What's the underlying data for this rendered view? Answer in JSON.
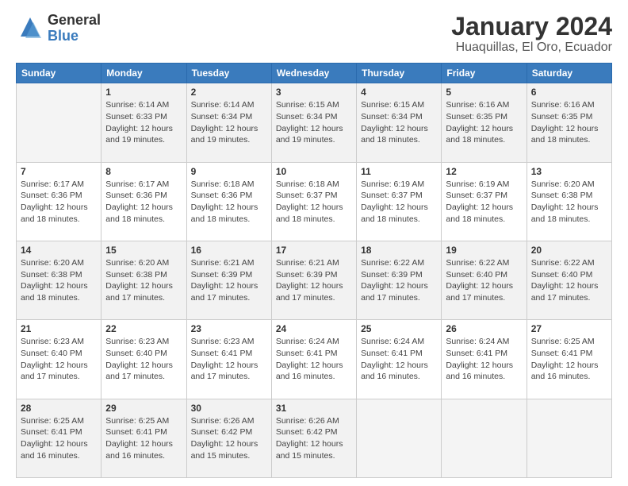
{
  "logo": {
    "general": "General",
    "blue": "Blue"
  },
  "title": "January 2024",
  "subtitle": "Huaquillas, El Oro, Ecuador",
  "days_header": [
    "Sunday",
    "Monday",
    "Tuesday",
    "Wednesday",
    "Thursday",
    "Friday",
    "Saturday"
  ],
  "weeks": [
    [
      {
        "day": "",
        "info": ""
      },
      {
        "day": "1",
        "info": "Sunrise: 6:14 AM\nSunset: 6:33 PM\nDaylight: 12 hours\nand 19 minutes."
      },
      {
        "day": "2",
        "info": "Sunrise: 6:14 AM\nSunset: 6:34 PM\nDaylight: 12 hours\nand 19 minutes."
      },
      {
        "day": "3",
        "info": "Sunrise: 6:15 AM\nSunset: 6:34 PM\nDaylight: 12 hours\nand 19 minutes."
      },
      {
        "day": "4",
        "info": "Sunrise: 6:15 AM\nSunset: 6:34 PM\nDaylight: 12 hours\nand 18 minutes."
      },
      {
        "day": "5",
        "info": "Sunrise: 6:16 AM\nSunset: 6:35 PM\nDaylight: 12 hours\nand 18 minutes."
      },
      {
        "day": "6",
        "info": "Sunrise: 6:16 AM\nSunset: 6:35 PM\nDaylight: 12 hours\nand 18 minutes."
      }
    ],
    [
      {
        "day": "7",
        "info": "Sunrise: 6:17 AM\nSunset: 6:36 PM\nDaylight: 12 hours\nand 18 minutes."
      },
      {
        "day": "8",
        "info": "Sunrise: 6:17 AM\nSunset: 6:36 PM\nDaylight: 12 hours\nand 18 minutes."
      },
      {
        "day": "9",
        "info": "Sunrise: 6:18 AM\nSunset: 6:36 PM\nDaylight: 12 hours\nand 18 minutes."
      },
      {
        "day": "10",
        "info": "Sunrise: 6:18 AM\nSunset: 6:37 PM\nDaylight: 12 hours\nand 18 minutes."
      },
      {
        "day": "11",
        "info": "Sunrise: 6:19 AM\nSunset: 6:37 PM\nDaylight: 12 hours\nand 18 minutes."
      },
      {
        "day": "12",
        "info": "Sunrise: 6:19 AM\nSunset: 6:37 PM\nDaylight: 12 hours\nand 18 minutes."
      },
      {
        "day": "13",
        "info": "Sunrise: 6:20 AM\nSunset: 6:38 PM\nDaylight: 12 hours\nand 18 minutes."
      }
    ],
    [
      {
        "day": "14",
        "info": "Sunrise: 6:20 AM\nSunset: 6:38 PM\nDaylight: 12 hours\nand 18 minutes."
      },
      {
        "day": "15",
        "info": "Sunrise: 6:20 AM\nSunset: 6:38 PM\nDaylight: 12 hours\nand 17 minutes."
      },
      {
        "day": "16",
        "info": "Sunrise: 6:21 AM\nSunset: 6:39 PM\nDaylight: 12 hours\nand 17 minutes."
      },
      {
        "day": "17",
        "info": "Sunrise: 6:21 AM\nSunset: 6:39 PM\nDaylight: 12 hours\nand 17 minutes."
      },
      {
        "day": "18",
        "info": "Sunrise: 6:22 AM\nSunset: 6:39 PM\nDaylight: 12 hours\nand 17 minutes."
      },
      {
        "day": "19",
        "info": "Sunrise: 6:22 AM\nSunset: 6:40 PM\nDaylight: 12 hours\nand 17 minutes."
      },
      {
        "day": "20",
        "info": "Sunrise: 6:22 AM\nSunset: 6:40 PM\nDaylight: 12 hours\nand 17 minutes."
      }
    ],
    [
      {
        "day": "21",
        "info": "Sunrise: 6:23 AM\nSunset: 6:40 PM\nDaylight: 12 hours\nand 17 minutes."
      },
      {
        "day": "22",
        "info": "Sunrise: 6:23 AM\nSunset: 6:40 PM\nDaylight: 12 hours\nand 17 minutes."
      },
      {
        "day": "23",
        "info": "Sunrise: 6:23 AM\nSunset: 6:41 PM\nDaylight: 12 hours\nand 17 minutes."
      },
      {
        "day": "24",
        "info": "Sunrise: 6:24 AM\nSunset: 6:41 PM\nDaylight: 12 hours\nand 16 minutes."
      },
      {
        "day": "25",
        "info": "Sunrise: 6:24 AM\nSunset: 6:41 PM\nDaylight: 12 hours\nand 16 minutes."
      },
      {
        "day": "26",
        "info": "Sunrise: 6:24 AM\nSunset: 6:41 PM\nDaylight: 12 hours\nand 16 minutes."
      },
      {
        "day": "27",
        "info": "Sunrise: 6:25 AM\nSunset: 6:41 PM\nDaylight: 12 hours\nand 16 minutes."
      }
    ],
    [
      {
        "day": "28",
        "info": "Sunrise: 6:25 AM\nSunset: 6:41 PM\nDaylight: 12 hours\nand 16 minutes."
      },
      {
        "day": "29",
        "info": "Sunrise: 6:25 AM\nSunset: 6:41 PM\nDaylight: 12 hours\nand 16 minutes."
      },
      {
        "day": "30",
        "info": "Sunrise: 6:26 AM\nSunset: 6:42 PM\nDaylight: 12 hours\nand 15 minutes."
      },
      {
        "day": "31",
        "info": "Sunrise: 6:26 AM\nSunset: 6:42 PM\nDaylight: 12 hours\nand 15 minutes."
      },
      {
        "day": "",
        "info": ""
      },
      {
        "day": "",
        "info": ""
      },
      {
        "day": "",
        "info": ""
      }
    ]
  ]
}
